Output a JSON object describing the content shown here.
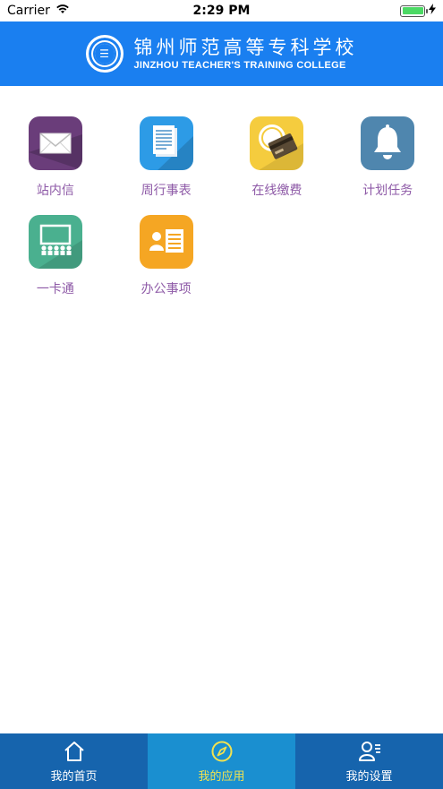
{
  "status_bar": {
    "carrier": "Carrier",
    "time": "2:29 PM",
    "battery_level": 1.0
  },
  "header": {
    "title_cn": "锦州师范高等专科学校",
    "title_en": "JINZHOU TEACHER'S TRAINING COLLEGE",
    "background": "#1a7ff0"
  },
  "apps": [
    {
      "label": "站内信",
      "icon": "mail-icon",
      "color": "#6a3d7a"
    },
    {
      "label": "周行事表",
      "icon": "document-icon",
      "color": "#2d9be6"
    },
    {
      "label": "在线缴费",
      "icon": "payment-icon",
      "color": "#f5cc3e"
    },
    {
      "label": "计划任务",
      "icon": "bell-icon",
      "color": "#4f86ae"
    },
    {
      "label": "一卡通",
      "icon": "classroom-icon",
      "color": "#4ab08f"
    },
    {
      "label": "办公事项",
      "icon": "contact-card-icon",
      "color": "#f5a623"
    }
  ],
  "tabbar": {
    "tabs": [
      {
        "label": "我的首页",
        "icon": "home-icon",
        "active": false
      },
      {
        "label": "我的应用",
        "icon": "compass-icon",
        "active": true
      },
      {
        "label": "我的设置",
        "icon": "user-settings-icon",
        "active": false
      }
    ],
    "background": "#1664ad",
    "active_background": "#1a8fd0",
    "active_color": "#f2e250"
  }
}
